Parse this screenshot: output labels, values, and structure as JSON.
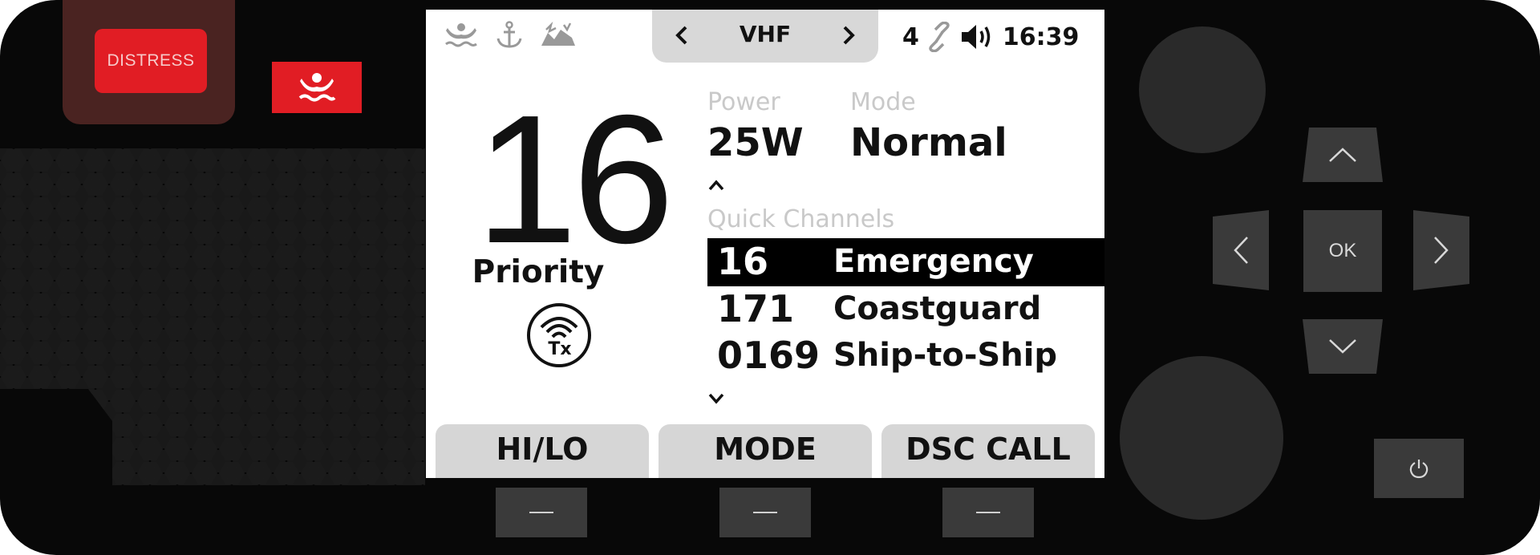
{
  "panel": {
    "distress_label": "DISTRESS",
    "mob_icon": "man-overboard-icon"
  },
  "status_bar": {
    "left_icons": [
      "man-overboard-icon",
      "anchor-icon",
      "aground-icon"
    ],
    "band": "VHF",
    "count": "4",
    "link_icon": "link-icon",
    "volume_icon": "speaker-volume-icon",
    "time": "16:39"
  },
  "main": {
    "channel": "16",
    "channel_tag": "Priority",
    "tx_label": "Tx",
    "power_label": "Power",
    "power_value": "25W",
    "mode_label": "Mode",
    "mode_value": "Normal"
  },
  "quick_channels": {
    "label": "Quick Channels",
    "items": [
      {
        "number": "16",
        "name": "Emergency",
        "selected": true
      },
      {
        "number": "171",
        "name": "Coastguard",
        "selected": false
      },
      {
        "number": "0169",
        "name": "Ship-to-Ship",
        "selected": false
      }
    ]
  },
  "softkeys": [
    "HI/LO",
    "MODE",
    "DSC CALL"
  ],
  "controls": {
    "ok_label": "OK",
    "power_icon": "power-icon"
  },
  "colors": {
    "distress_red": "#e11d24",
    "body": "#080808",
    "selected_row": "#000000"
  }
}
